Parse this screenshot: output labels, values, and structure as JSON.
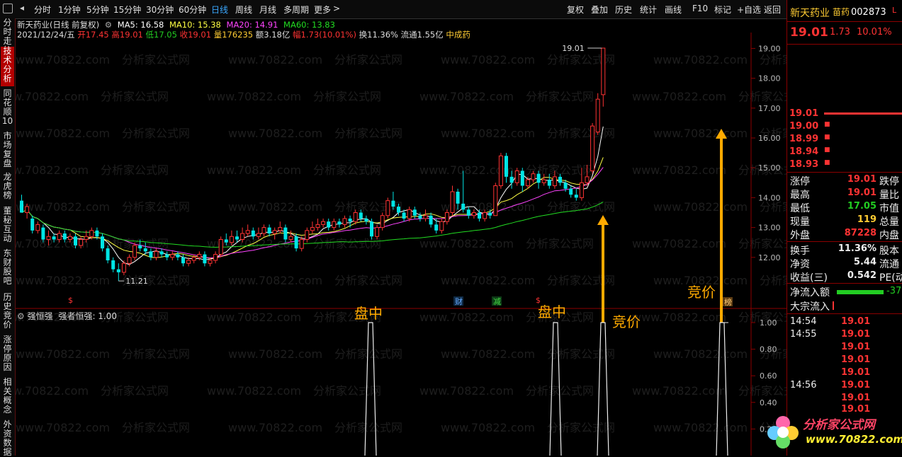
{
  "toolbar": {
    "periods": [
      "分时",
      "1分钟",
      "5分钟",
      "15分钟",
      "30分钟",
      "60分钟",
      "日线",
      "周线",
      "月线",
      "多周期",
      "更多"
    ],
    "active_period": "日线",
    "right_items": [
      "复权",
      "叠加",
      "历史",
      "统计",
      "画线",
      "F10",
      "标记",
      "+自选",
      "返回"
    ]
  },
  "sidebar": [
    "分时走势",
    "技术分析",
    "同花顺10",
    "市场复盘",
    "龙虎榜",
    "董秘互动",
    "东财股吧",
    "历史竞价",
    "涨停原因",
    "相关概念",
    "外资数据"
  ],
  "sidebar_active": "技术分析",
  "header": {
    "title": "新天药业(日线 前复权)",
    "ma5": "MA5: 16.58",
    "ma10": "MA10: 15.38",
    "ma20": "MA20: 14.91",
    "ma60": "MA60: 13.83",
    "date": "2021/12/24/五",
    "open": "开17.45",
    "high": "高19.01",
    "low": "低17.05",
    "close": "收19.01",
    "volume": "量176235",
    "amount": "额3.18亿",
    "change": "幅1.73(10.01%)",
    "turnover": "换11.36%",
    "float": "流通1.55亿",
    "industry": "中成药"
  },
  "indicator": {
    "name": "强恒强",
    "param": "强者恒强: 1.00"
  },
  "price_axis": [
    "19.00",
    "18.00",
    "17.00",
    "16.00",
    "15.00",
    "14.00",
    "13.00",
    "12.00"
  ],
  "ind_axis": [
    "1.00",
    "0.80",
    "0.60",
    "0.40",
    "0.20"
  ],
  "annotations": {
    "high_label": "19.01",
    "low_label": "11.21",
    "pan_zhong_1": "盘中",
    "pan_zhong_2": "盘中",
    "jing_jia_1": "竞价",
    "jing_jia_2": "竞价",
    "cai": "财",
    "jian": "减",
    "bang": "榜",
    "dollar": "$"
  },
  "chart_data": {
    "type": "candlestick",
    "ylim": [
      11.0,
      19.2
    ],
    "candles": [
      [
        13.9,
        13.5,
        14.1,
        13.5
      ],
      [
        13.5,
        13.7,
        13.8,
        13.3
      ],
      [
        13.3,
        12.9,
        13.4,
        12.8
      ],
      [
        12.9,
        13.1,
        13.2,
        12.8
      ],
      [
        13.0,
        12.6,
        13.1,
        12.5
      ],
      [
        12.6,
        12.7,
        12.9,
        12.4
      ],
      [
        12.7,
        12.6,
        12.8,
        12.5
      ],
      [
        12.6,
        12.8,
        12.9,
        12.5
      ],
      [
        12.8,
        12.6,
        12.9,
        12.5
      ],
      [
        12.6,
        12.7,
        12.8,
        12.5
      ],
      [
        12.7,
        12.4,
        12.8,
        12.3
      ],
      [
        12.4,
        12.6,
        12.7,
        12.3
      ],
      [
        12.6,
        12.7,
        12.9,
        12.5
      ],
      [
        12.7,
        12.9,
        13.0,
        12.6
      ],
      [
        12.9,
        12.7,
        13.0,
        12.6
      ],
      [
        12.7,
        12.3,
        12.8,
        12.2
      ],
      [
        12.3,
        11.9,
        12.4,
        11.8
      ],
      [
        11.9,
        11.6,
        12.0,
        11.5
      ],
      [
        11.6,
        11.5,
        11.8,
        11.21
      ],
      [
        11.5,
        11.8,
        11.9,
        11.4
      ],
      [
        11.8,
        12.0,
        12.1,
        11.7
      ],
      [
        12.0,
        12.4,
        12.5,
        11.9
      ],
      [
        12.4,
        12.3,
        12.6,
        12.2
      ],
      [
        12.3,
        12.2,
        12.5,
        12.1
      ],
      [
        12.2,
        12.0,
        12.3,
        11.9
      ],
      [
        12.0,
        12.2,
        12.3,
        11.9
      ],
      [
        12.2,
        12.1,
        12.3,
        12.0
      ],
      [
        12.1,
        12.0,
        12.2,
        11.9
      ],
      [
        12.0,
        12.1,
        12.2,
        11.9
      ],
      [
        12.1,
        12.0,
        12.2,
        11.9
      ],
      [
        12.0,
        11.8,
        12.1,
        11.7
      ],
      [
        11.8,
        11.9,
        12.0,
        11.7
      ],
      [
        11.9,
        12.0,
        12.1,
        11.8
      ],
      [
        12.0,
        12.1,
        12.2,
        11.9
      ],
      [
        12.1,
        11.8,
        12.2,
        11.7
      ],
      [
        11.8,
        11.9,
        12.0,
        11.7
      ],
      [
        11.9,
        12.1,
        12.2,
        11.8
      ],
      [
        12.1,
        12.6,
        12.7,
        12.0
      ],
      [
        12.6,
        12.5,
        12.8,
        12.4
      ],
      [
        12.5,
        12.7,
        12.9,
        12.4
      ],
      [
        12.7,
        12.6,
        12.9,
        12.5
      ],
      [
        12.6,
        12.8,
        13.0,
        12.5
      ],
      [
        12.8,
        12.9,
        13.1,
        12.7
      ],
      [
        12.9,
        12.7,
        13.0,
        12.6
      ],
      [
        12.7,
        12.8,
        13.0,
        12.6
      ],
      [
        12.8,
        13.0,
        13.1,
        12.7
      ],
      [
        13.0,
        12.8,
        13.1,
        12.7
      ],
      [
        12.8,
        12.9,
        13.0,
        12.6
      ],
      [
        12.9,
        13.0,
        13.2,
        12.8
      ],
      [
        13.0,
        12.6,
        13.1,
        12.5
      ],
      [
        12.6,
        12.7,
        12.9,
        12.5
      ],
      [
        12.7,
        12.3,
        12.8,
        12.2
      ],
      [
        12.3,
        12.6,
        12.7,
        12.2
      ],
      [
        12.6,
        12.9,
        13.0,
        12.5
      ],
      [
        12.9,
        13.0,
        13.2,
        12.8
      ],
      [
        13.0,
        13.1,
        13.3,
        12.9
      ],
      [
        13.1,
        13.2,
        13.3,
        13.0
      ],
      [
        13.2,
        13.0,
        13.3,
        12.9
      ],
      [
        13.0,
        13.2,
        13.3,
        12.9
      ],
      [
        13.2,
        13.1,
        13.3,
        13.0
      ],
      [
        13.1,
        13.3,
        13.4,
        13.0
      ],
      [
        13.3,
        13.2,
        13.4,
        13.0
      ],
      [
        13.2,
        13.5,
        13.6,
        13.1
      ],
      [
        13.5,
        13.3,
        13.6,
        13.2
      ],
      [
        13.3,
        13.2,
        13.4,
        13.1
      ],
      [
        13.2,
        12.7,
        13.3,
        12.6
      ],
      [
        12.7,
        13.0,
        13.1,
        12.6
      ],
      [
        13.0,
        13.4,
        13.5,
        12.9
      ],
      [
        13.4,
        13.9,
        14.0,
        13.3
      ],
      [
        13.9,
        13.7,
        14.2,
        13.6
      ],
      [
        13.7,
        13.5,
        13.8,
        13.4
      ],
      [
        13.5,
        13.3,
        13.6,
        13.2
      ],
      [
        13.3,
        13.6,
        13.7,
        13.2
      ],
      [
        13.6,
        13.4,
        13.7,
        13.3
      ],
      [
        13.4,
        13.3,
        13.5,
        13.2
      ],
      [
        13.3,
        13.4,
        13.6,
        13.2
      ],
      [
        13.4,
        13.1,
        13.5,
        13.0
      ],
      [
        13.1,
        12.9,
        13.3,
        12.8
      ],
      [
        12.9,
        13.2,
        13.3,
        12.8
      ],
      [
        13.2,
        13.5,
        13.6,
        13.1
      ],
      [
        13.5,
        14.2,
        14.4,
        13.4
      ],
      [
        14.2,
        13.8,
        14.3,
        13.6
      ],
      [
        13.8,
        13.6,
        14.9,
        13.5
      ],
      [
        13.6,
        13.4,
        13.7,
        13.3
      ],
      [
        13.4,
        13.5,
        13.6,
        13.3
      ],
      [
        13.5,
        13.3,
        13.6,
        13.2
      ],
      [
        13.3,
        13.5,
        13.6,
        13.2
      ],
      [
        13.5,
        13.4,
        13.6,
        13.3
      ],
      [
        13.4,
        14.4,
        14.5,
        13.9
      ],
      [
        14.4,
        15.4,
        15.5,
        14.3
      ],
      [
        15.4,
        14.7,
        15.5,
        14.5
      ],
      [
        14.7,
        14.5,
        14.9,
        14.3
      ],
      [
        14.5,
        14.9,
        15.0,
        14.4
      ],
      [
        14.9,
        14.4,
        15.0,
        14.2
      ],
      [
        14.4,
        14.6,
        14.7,
        14.3
      ],
      [
        14.6,
        14.8,
        14.9,
        14.5
      ],
      [
        14.8,
        14.5,
        14.9,
        14.3
      ],
      [
        14.5,
        14.6,
        14.8,
        14.4
      ],
      [
        14.6,
        14.4,
        14.8,
        14.3
      ],
      [
        14.4,
        14.7,
        14.9,
        14.3
      ],
      [
        14.7,
        14.5,
        14.8,
        14.4
      ],
      [
        14.5,
        14.3,
        14.6,
        14.2
      ],
      [
        14.3,
        14.1,
        14.4,
        14.0
      ],
      [
        14.1,
        14.0,
        14.3,
        13.9
      ],
      [
        14.0,
        14.5,
        15.0,
        13.9
      ],
      [
        14.5,
        14.7,
        15.1,
        14.4
      ],
      [
        14.9,
        16.4,
        16.5,
        14.8
      ],
      [
        16.2,
        17.3,
        17.5,
        16.1
      ],
      [
        17.45,
        19.01,
        19.01,
        17.05
      ]
    ]
  },
  "right": {
    "name": "新天药业",
    "tag": "苗药",
    "code": "002873",
    "price": "19.01",
    "change": "1.73",
    "pct": "10.01%",
    "queue": [
      "19.01",
      "19.00",
      "18.99",
      "18.94",
      "18.93"
    ],
    "rows": [
      {
        "k": "涨停",
        "v": "19.01",
        "k2": "跌停"
      },
      {
        "k": "最高",
        "v": "19.01",
        "k2": "量比"
      },
      {
        "k": "最低",
        "v": "17.05",
        "k2": "市值"
      },
      {
        "k": "现量",
        "v": "119",
        "k2": "总量"
      },
      {
        "k": "外盘",
        "v": "87228",
        "k2": "内盘"
      }
    ],
    "rows2": [
      {
        "k": "换手",
        "v": "11.36%",
        "k2": "股本"
      },
      {
        "k": "净资",
        "v": "5.44",
        "k2": "流通"
      },
      {
        "k": "收益(三)",
        "v": "0.542",
        "k2": "PE(动"
      }
    ],
    "net_inflow_label": "净流入额",
    "net_inflow_val": "-37",
    "block_label": "大宗流入",
    "ticks_times": [
      "14:54",
      "14:55",
      "14:56"
    ],
    "ticks_prices": [
      "19.01",
      "19.01",
      "19.01",
      "19.01",
      "19.01",
      "19.01",
      "19.01",
      "19.01",
      "19.01"
    ],
    "logo_text": "分析家公式网",
    "logo_url": "www.70822.com"
  },
  "watermark": "www.70822.com",
  "watermark_cn": "分析家公式网"
}
